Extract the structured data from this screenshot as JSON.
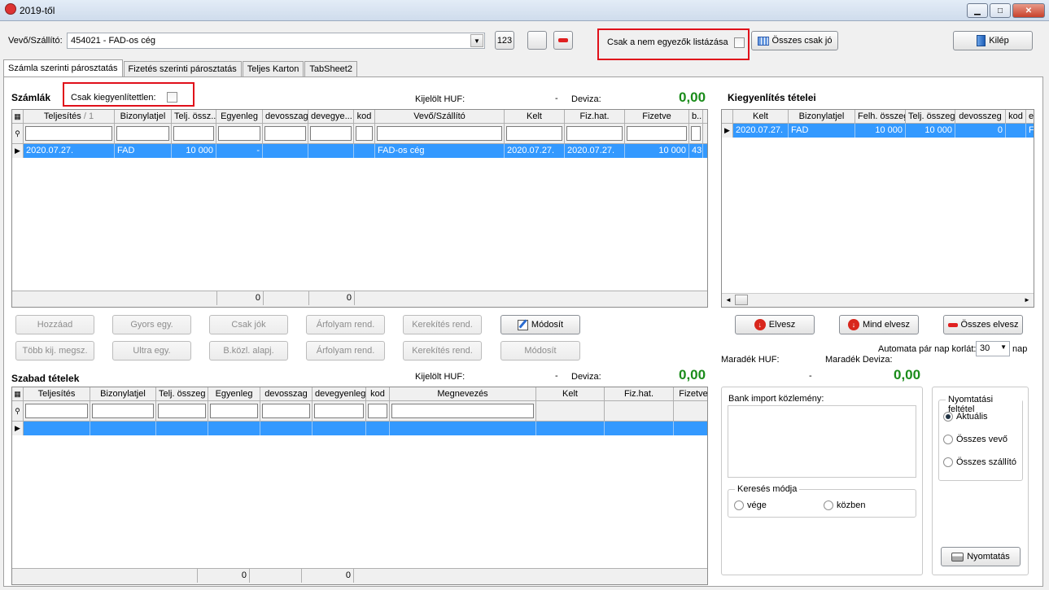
{
  "window": {
    "title": "2019-től"
  },
  "top": {
    "partner_label": "Vevő/Szállító:",
    "partner_value": "454021 - FAD-os cég",
    "btn_123": "123",
    "nonmatching_label": "Csak a nem egyezők listázása",
    "all_only_good": "Összes csak jó",
    "exit": "Kilép"
  },
  "tabs": [
    "Számla szerinti párosztatás",
    "Fizetés szerinti párosztatás",
    "Teljes Karton",
    "TabSheet2"
  ],
  "invoices": {
    "title": "Számlák",
    "only_unsettled": "Csak kiegyenlítettlen:",
    "selected_huf_label": "Kijelölt HUF:",
    "selected_huf_value": "-",
    "currency_label": "Deviza:",
    "currency_value": "0,00",
    "columns": [
      "Teljesítés",
      "Bizonylatjel",
      "Telj. össz...",
      "Egyenleg",
      "devosszag",
      "devegye...",
      "kod",
      "Vevő/Szállító",
      "Kelt",
      "Fiz.hat.",
      "Fizetve",
      "b..."
    ],
    "sort_mark": "/ 1",
    "rows": [
      [
        "2020.07.27.",
        "FAD",
        "10 000",
        "-",
        "",
        "",
        "",
        "FAD-os cég",
        "2020.07.27.",
        "2020.07.27.",
        "10 000",
        "43"
      ]
    ],
    "footer": [
      "0",
      "0"
    ]
  },
  "buttons_row1": [
    "Hozzáad",
    "Gyors egy.",
    "Csak jók",
    "Árfolyam rend.",
    "Kerekítés rend.",
    "Módosít"
  ],
  "buttons_row2": [
    "Több kij. megsz.",
    "Ultra egy.",
    "B.közl. alapj.",
    "Árfolyam rend.",
    "Kerekítés rend.",
    "Módosít"
  ],
  "free_items": {
    "title": "Szabad tételek",
    "selected_huf_label": "Kijelölt HUF:",
    "selected_huf_value": "-",
    "currency_label": "Deviza:",
    "currency_value": "0,00",
    "columns": [
      "Teljesítés",
      "Bizonylatjel",
      "Telj. összeg",
      "Egyenleg",
      "devosszag",
      "devegyenleg",
      "kod",
      "Megnevezés",
      "Kelt",
      "Fiz.hat.",
      "Fizetve"
    ],
    "footer": [
      "0",
      "0"
    ]
  },
  "settlement": {
    "title": "Kiegyenlítés tételei",
    "columns": [
      "Kelt",
      "Bizonylatjel",
      "Felh. összeg",
      "Telj. összeg",
      "devosszeg",
      "kod",
      "e"
    ],
    "rows": [
      [
        "2020.07.27.",
        "FAD",
        "10 000",
        "10 000",
        "0",
        "",
        "F"
      ]
    ],
    "btn_remove": "Elvesz",
    "btn_remove_all": "Mind elvesz",
    "btn_all_remove": "Összes elvesz",
    "auto_label": "Automata pár nap korlát:",
    "auto_value": "30",
    "auto_unit": "nap",
    "remaining_huf_label": "Maradék HUF:",
    "remaining_currency_label": "Maradék Deviza:",
    "remaining_huf_value": "-",
    "remaining_currency_value": "0,00"
  },
  "bank": {
    "label": "Bank import közlemény:",
    "search_mode": "Keresés módja",
    "opt_end": "vége",
    "opt_middle": "közben"
  },
  "print": {
    "title": "Nyomtatási feltétel",
    "opt1": "Aktuális",
    "opt2": "Összes vevő",
    "opt3": "Összes szállító",
    "btn": "Nyomtatás"
  }
}
